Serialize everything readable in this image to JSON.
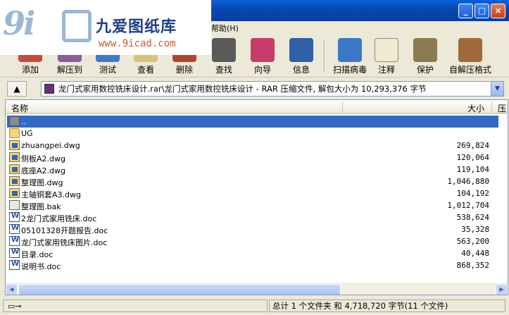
{
  "menu": {
    "help_label": "帮助(H)"
  },
  "logo": {
    "brand": "九爱图纸库",
    "url": "www.9icad.com"
  },
  "toolbar": {
    "buttons": [
      {
        "label": "添加",
        "icon": "add-icon"
      },
      {
        "label": "解压到",
        "icon": "extract-icon"
      },
      {
        "label": "测试",
        "icon": "test-icon"
      },
      {
        "label": "查看",
        "icon": "view-icon"
      },
      {
        "label": "删除",
        "icon": "delete-icon"
      },
      {
        "label": "查找",
        "icon": "find-icon"
      },
      {
        "label": "向导",
        "icon": "wizard-icon"
      },
      {
        "label": "信息",
        "icon": "info-icon"
      },
      {
        "label": "扫描病毒",
        "icon": "virus-scan-icon"
      },
      {
        "label": "注释",
        "icon": "comment-icon"
      },
      {
        "label": "保护",
        "icon": "protect-icon"
      },
      {
        "label": "自解压格式",
        "icon": "sfx-icon"
      }
    ]
  },
  "address": {
    "text": "龙门式家用数控铣床设计.rar\\龙门式家用数控铣床设计 - RAR 压缩文件, 解包大小为 10,293,376 字节"
  },
  "columns": {
    "name": "名称",
    "size": "大小",
    "packed": "压"
  },
  "files": [
    {
      "name": "..",
      "size": "",
      "type": "up"
    },
    {
      "name": "UG",
      "size": "",
      "type": "folder"
    },
    {
      "name": "zhuangpei.dwg",
      "size": "269,824",
      "type": "dwg"
    },
    {
      "name": "侧板A2.dwg",
      "size": "120,064",
      "type": "dwg"
    },
    {
      "name": "底座A2.dwg",
      "size": "119,104",
      "type": "dwg"
    },
    {
      "name": "整理图.dwg",
      "size": "1,046,880",
      "type": "dwg"
    },
    {
      "name": "主轴铜套A3.dwg",
      "size": "104,192",
      "type": "dwg"
    },
    {
      "name": "整理图.bak",
      "size": "1,012,704",
      "type": "bak"
    },
    {
      "name": "2龙门式家用铣床.doc",
      "size": "538,624",
      "type": "doc"
    },
    {
      "name": "05101328开题报告.doc",
      "size": "35,328",
      "type": "doc"
    },
    {
      "name": "龙门式家用铣床图片.doc",
      "size": "563,200",
      "type": "doc"
    },
    {
      "name": "目录.doc",
      "size": "40,448",
      "type": "doc"
    },
    {
      "name": "说明书.doc",
      "size": "868,352",
      "type": "doc"
    }
  ],
  "status": {
    "summary": "总计 1 个文件夹 和 4,718,720 字节(11 个文件)"
  }
}
